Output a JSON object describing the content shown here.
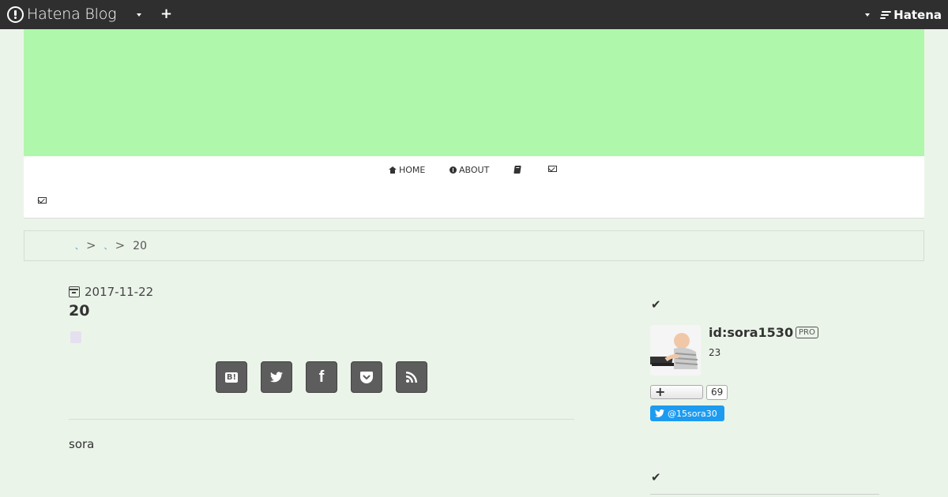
{
  "topbar": {
    "brand": "Hatena Blog",
    "hatena": "Hatena"
  },
  "nav": {
    "home": "HOME",
    "about": "ABOUT"
  },
  "breadcrumb": {
    "link1": "、",
    "link2": "、",
    "sep": ">",
    "current": "20"
  },
  "article": {
    "date": "2017-11-22",
    "title": "20",
    "body": "sora",
    "share_buttons": [
      "B!",
      "twitter",
      "f",
      "pocket",
      "rss"
    ]
  },
  "sidebar": {
    "profile_id": "id:sora1530",
    "badge": "PRO",
    "count_text": "23",
    "subscribe_count": "69",
    "twitter_handle": "@15sora30"
  },
  "colors": {
    "topbar": "#2f2f2f",
    "banner": "#aff7ab",
    "page_bg": "#ebf4e9",
    "share_btn": "#5d5d5d",
    "twitter": "#1d9bf0"
  }
}
